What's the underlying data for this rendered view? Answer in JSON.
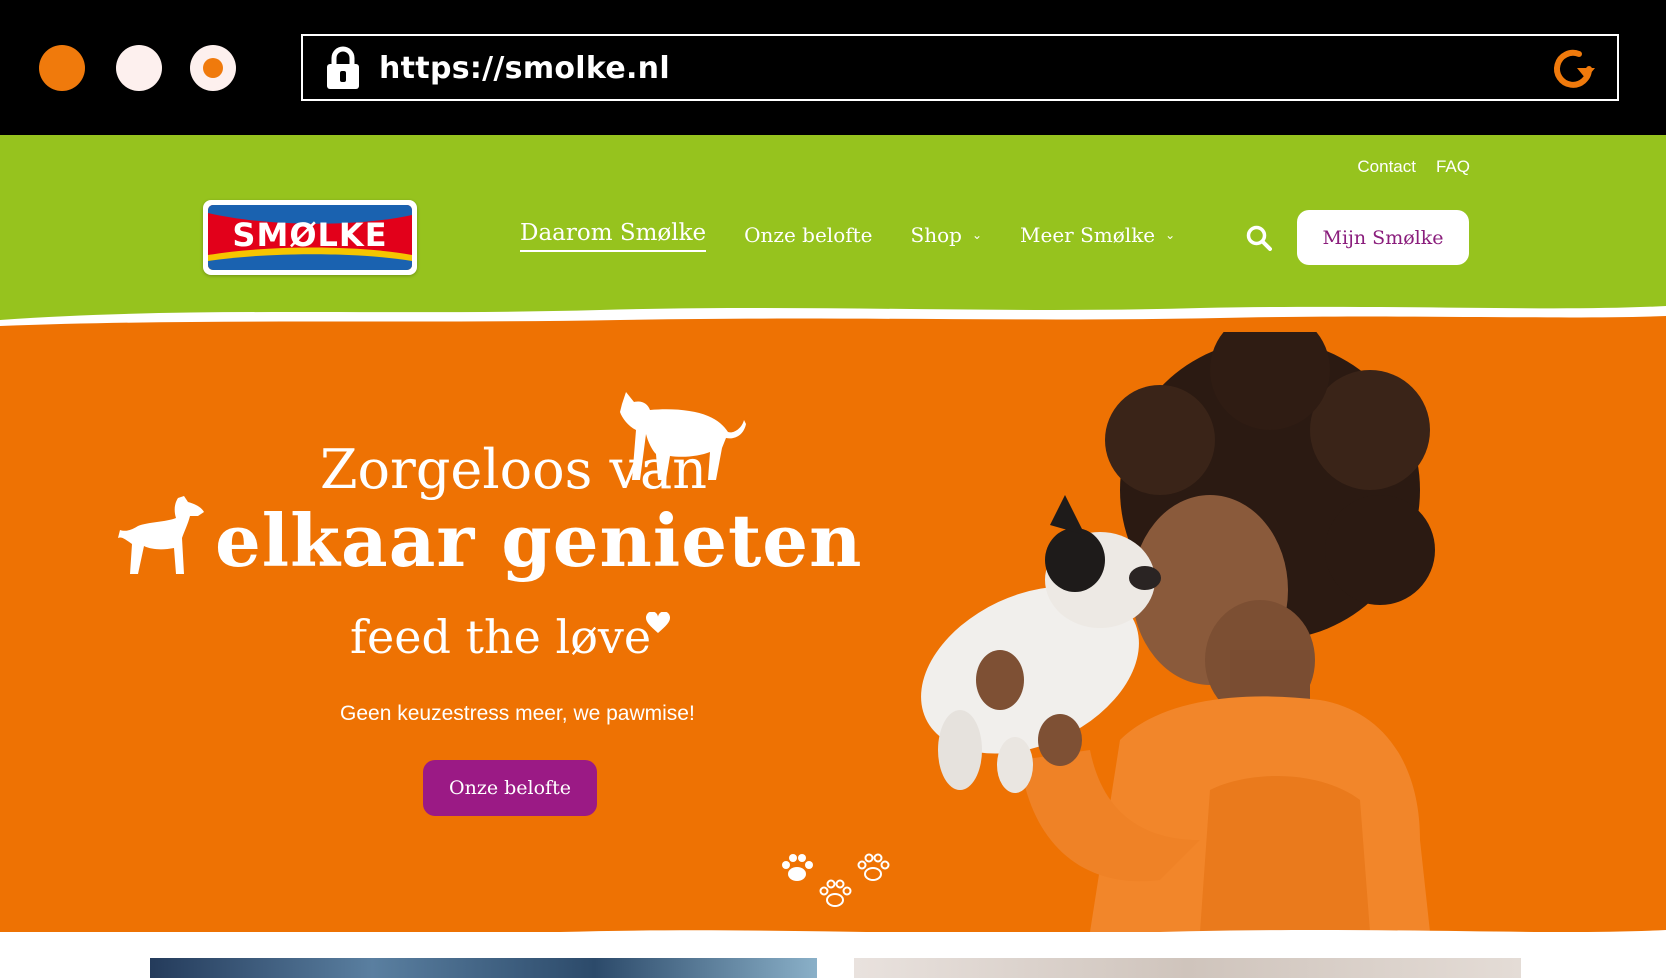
{
  "browser": {
    "url": "https://smolke.nl",
    "dot_colors": [
      "#f07a0c",
      "#fdf0ee",
      "#fdf0ee"
    ],
    "accent": "#f07a0c"
  },
  "header": {
    "bg_color": "#96c31e",
    "top_links": [
      "Contact",
      "FAQ"
    ],
    "logo_text": "SMØLKE",
    "nav": [
      {
        "label": "Daarom Smølke",
        "active": true
      },
      {
        "label": "Onze belofte"
      },
      {
        "label": "Shop",
        "dropdown": true
      },
      {
        "label": "Meer Smølke",
        "dropdown": true
      }
    ],
    "search_icon": "search-icon",
    "account_button": "Mijn Smølke"
  },
  "hero": {
    "bg_color": "#ee7203",
    "headline_line1": "Zorgeloos van",
    "headline_line2": "elkaar genieten",
    "tagline": "feed the løve",
    "subtext": "Geen keuzestress meer, we pawmise!",
    "cta_label": "Onze belofte",
    "cta_color": "#9b1a85"
  }
}
